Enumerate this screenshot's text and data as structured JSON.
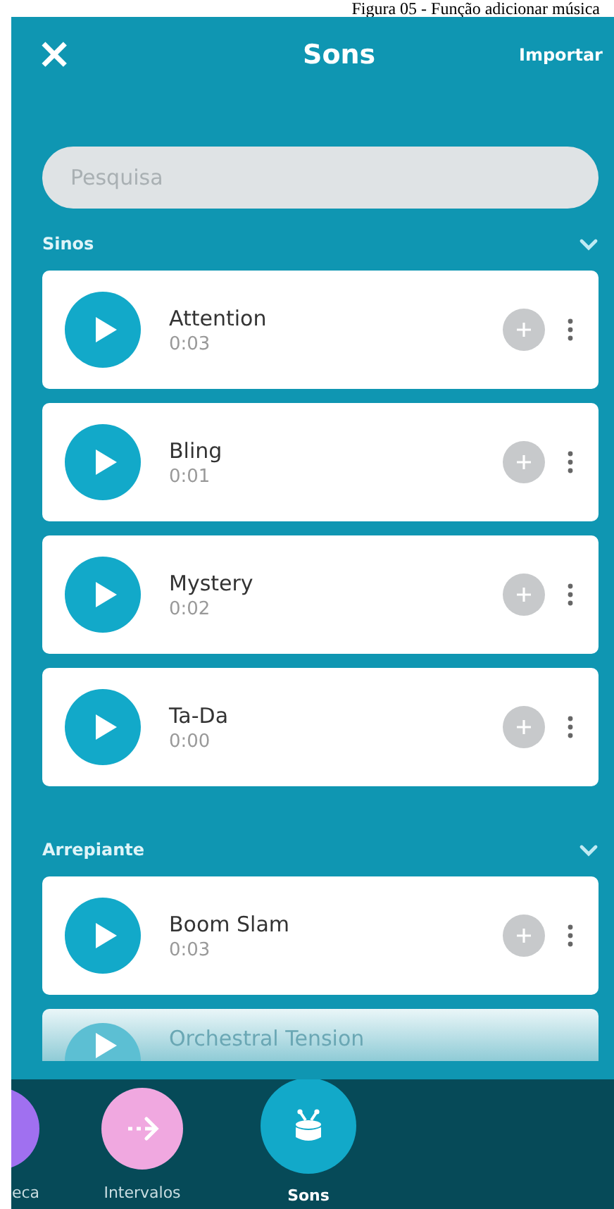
{
  "caption": "Figura 05 - Função adicionar música",
  "header": {
    "close": "×",
    "title": "Sons",
    "action": "Importar"
  },
  "search": {
    "placeholder": "Pesquisa"
  },
  "sections": [
    {
      "title": "Sinos",
      "expanded": true,
      "sounds": [
        {
          "name": "Attention",
          "duration": "0:03",
          "faded": false
        },
        {
          "name": "Bling",
          "duration": "0:01",
          "faded": false
        },
        {
          "name": "Mystery",
          "duration": "0:02",
          "faded": false
        },
        {
          "name": "Ta-Da",
          "duration": "0:00",
          "faded": false
        }
      ]
    },
    {
      "title": "Arrepiante",
      "expanded": true,
      "sounds": [
        {
          "name": "Boom Slam",
          "duration": "0:03",
          "faded": false
        },
        {
          "name": "Orchestral Tension",
          "faded": true
        }
      ]
    }
  ],
  "nav": [
    {
      "label": "eca",
      "color": "#a070f0",
      "kind": "library",
      "selected": false
    },
    {
      "label": "Intervalos",
      "color": "#f0a8e0",
      "kind": "intervals",
      "selected": false
    },
    {
      "label": "Sons",
      "color": "#12a9c9",
      "kind": "sounds",
      "selected": true
    }
  ]
}
